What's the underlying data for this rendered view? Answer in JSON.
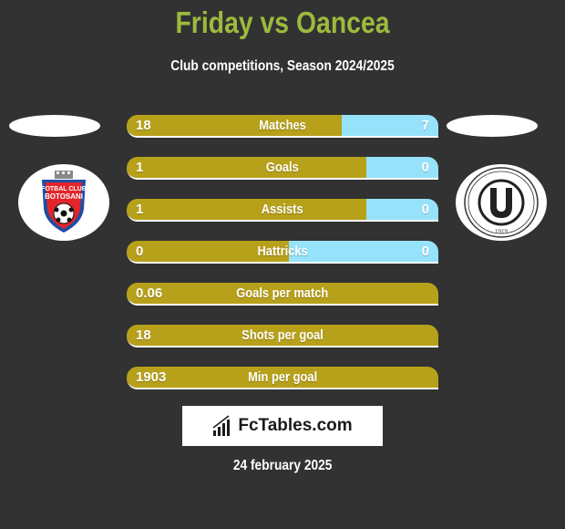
{
  "header": {
    "title": "Friday vs Oancea",
    "subtitle": "Club competitions, Season 2024/2025"
  },
  "colors": {
    "background": "#323232",
    "title": "#9dba3d",
    "left_bar": "#b8a11a",
    "right_bar": "#97e2fb"
  },
  "teams": {
    "left": {
      "name": "Fotbal Club Botosani",
      "logo_icon": "fc-botosani-crest"
    },
    "right": {
      "name": "F.C. Universitatea Cluj",
      "logo_icon": "u-cluj-crest",
      "logo_text": "F.C. UNIVERSITATEA CLUJ",
      "logo_year": "1919"
    }
  },
  "stats": [
    {
      "label": "Matches",
      "left": "18",
      "right": "7",
      "left_share": 0.69
    },
    {
      "label": "Goals",
      "left": "1",
      "right": "0",
      "left_share": 0.77
    },
    {
      "label": "Assists",
      "left": "1",
      "right": "0",
      "left_share": 0.77
    },
    {
      "label": "Hattricks",
      "left": "0",
      "right": "0",
      "left_share": 0.52
    },
    {
      "label": "Goals per match",
      "left": "0.06",
      "right": "",
      "left_share": 1.0
    },
    {
      "label": "Shots per goal",
      "left": "18",
      "right": "",
      "left_share": 1.0
    },
    {
      "label": "Min per goal",
      "left": "1903",
      "right": "",
      "left_share": 1.0
    }
  ],
  "brand": {
    "text": "FcTables.com",
    "icon": "bar-chart-icon"
  },
  "date": "24 february 2025"
}
